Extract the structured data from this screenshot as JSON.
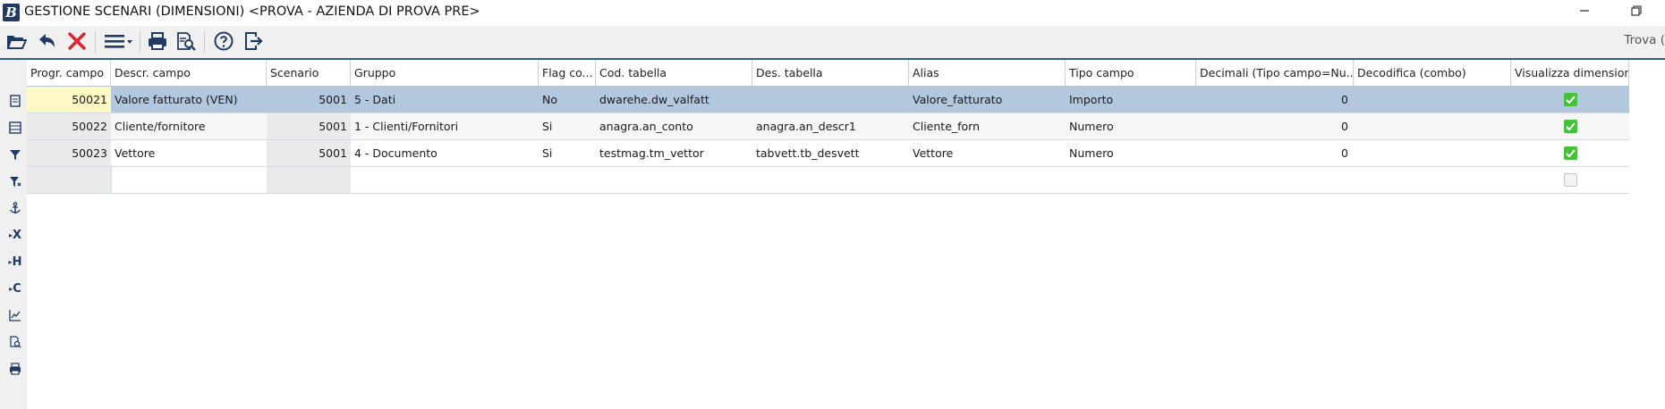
{
  "window": {
    "app_logo": "B",
    "title": "GESTIONE SCENARI (DIMENSIONI) <PROVA - AZIENDA DI PROVA PRE>",
    "minimize_icon": "minimize-icon",
    "restore_icon": "restore-icon"
  },
  "toolbar": {
    "buttons": [
      "open-folder-icon",
      "undo-icon",
      "delete-icon",
      "menu-icon",
      "print-icon",
      "print-preview-icon",
      "help-icon",
      "exit-icon"
    ],
    "find_label": "Trova ("
  },
  "sidebar": {
    "icons": [
      "document-icon",
      "list-icon",
      "filter-icon",
      "filter-clear-icon",
      "anchor-icon",
      "x-column-icon",
      "h-column-icon",
      "c-column-icon",
      "chart-icon",
      "zoom-doc-icon",
      "print-icon"
    ],
    "labels": [
      "X",
      "H",
      "C"
    ]
  },
  "grid": {
    "columns": [
      "Progr. campo",
      "Descr. campo",
      "Scenario",
      "Gruppo",
      "Flag co...",
      "Cod. tabella",
      "Des. tabella",
      "Alias",
      "Tipo campo",
      "Decimali (Tipo campo=Nu...",
      "Decodifica (combo)",
      "Visualizza dimensione"
    ],
    "rows": [
      {
        "progr": "50021",
        "descr": "Valore fatturato (VEN)",
        "scenario": "5001",
        "gruppo": "5 - Dati",
        "flag": "No",
        "cod_tabella": "dwarehe.dw_valfatt",
        "des_tabella": "",
        "alias": "Valore_fatturato",
        "tipo": "Importo",
        "decimali": "0",
        "decodifica": "",
        "visualizza": true
      },
      {
        "progr": "50022",
        "descr": "Cliente/fornitore",
        "scenario": "5001",
        "gruppo": "1 - Clienti/Fornitori",
        "flag": "Si",
        "cod_tabella": "anagra.an_conto",
        "des_tabella": "anagra.an_descr1",
        "alias": "Cliente_forn",
        "tipo": "Numero",
        "decimali": "0",
        "decodifica": "",
        "visualizza": true
      },
      {
        "progr": "50023",
        "descr": "Vettore",
        "scenario": "5001",
        "gruppo": "4 - Documento",
        "flag": "Si",
        "cod_tabella": "testmag.tm_vettor",
        "des_tabella": "tabvett.tb_desvett",
        "alias": "Vettore",
        "tipo": "Numero",
        "decimali": "0",
        "decodifica": "",
        "visualizza": true
      },
      {
        "progr": "",
        "descr": "",
        "scenario": "",
        "gruppo": "",
        "flag": "",
        "cod_tabella": "",
        "des_tabella": "",
        "alias": "",
        "tipo": "",
        "decimali": "",
        "decodifica": "",
        "visualizza": false
      }
    ]
  },
  "colors": {
    "selected_row": "#b3c8df",
    "checkbox_on": "#43c23a",
    "accent": "#1f3b63"
  }
}
